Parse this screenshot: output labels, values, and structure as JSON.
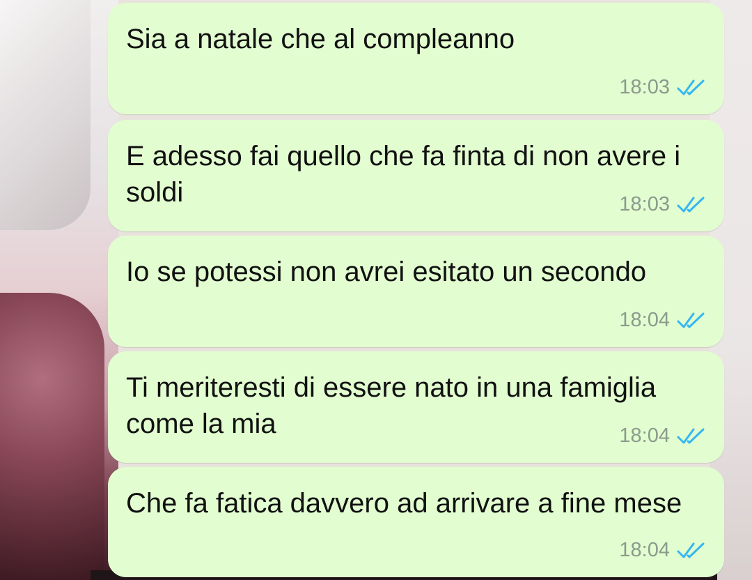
{
  "messages": [
    {
      "text": "Sia a natale che al compleanno",
      "time": "18:03",
      "status": "read"
    },
    {
      "text": "E adesso fai quello che fa finta di non avere i soldi",
      "time": "18:03",
      "status": "read"
    },
    {
      "text": "Io se potessi non avrei esitato un secondo",
      "time": "18:04",
      "status": "read"
    },
    {
      "text": "Ti meriteresti di essere nato in una famiglia come la mia",
      "time": "18:04",
      "status": "read"
    },
    {
      "text": "Che fa fatica davvero ad arrivare a fine mese",
      "time": "18:04",
      "status": "read"
    }
  ],
  "colors": {
    "bubble": "#e2fdd0",
    "read_tick": "#34b7f1",
    "time": "#8c9a8d"
  },
  "icons": {
    "read_receipt": "double-check-icon"
  }
}
